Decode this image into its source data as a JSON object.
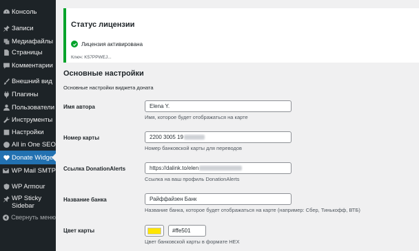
{
  "sidebar": {
    "items": [
      {
        "label": "Консоль",
        "icon": "dashboard-icon"
      },
      {
        "label": "Записи",
        "icon": "pin-icon"
      },
      {
        "label": "Медиафайлы",
        "icon": "media-icon"
      },
      {
        "label": "Страницы",
        "icon": "pages-icon"
      },
      {
        "label": "Комментарии",
        "icon": "comment-icon"
      },
      {
        "label": "Внешний вид",
        "icon": "brush-icon"
      },
      {
        "label": "Плагины",
        "icon": "plugin-icon"
      },
      {
        "label": "Пользователи",
        "icon": "users-icon"
      },
      {
        "label": "Инструменты",
        "icon": "wrench-icon"
      },
      {
        "label": "Настройки",
        "icon": "settings-icon"
      },
      {
        "label": "All in One SEO",
        "icon": "seo-icon"
      },
      {
        "label": "Donate Widget",
        "icon": "donate-icon"
      },
      {
        "label": "WP Mail SMTP",
        "icon": "mail-icon"
      },
      {
        "label": "WP Armour",
        "icon": "shield-icon"
      },
      {
        "label": "WP Sticky Sidebar",
        "icon": "sticky-icon"
      },
      {
        "label": "Свернуть меню",
        "icon": "collapse-icon"
      }
    ]
  },
  "notice": {
    "title": "Статус лицензии",
    "status": "Лицензия активирована",
    "key": "Ключ: K57PPWEJ..."
  },
  "settings": {
    "title": "Основные настройки",
    "description": "Основные настройки виджета доната",
    "author": {
      "label": "Имя автора",
      "value": "Elena Y.",
      "hint": "Имя, которое будет отображаться на карте"
    },
    "card": {
      "label": "Номер карты",
      "value": "2200 3005 19",
      "hint": "Номер банковской карты для переводов"
    },
    "link": {
      "label": "Ссылка DonationAlerts",
      "value": "https://dalink.to/elen",
      "hint": "Ссылка на ваш профиль DonationAlerts"
    },
    "bank": {
      "label": "Название банка",
      "value": "Райффайзен Банк",
      "hint": "Название банка, которое будет отображаться на карте (например: Сбер, Тинькофф, ВТБ)"
    },
    "color": {
      "label": "Цвет карты",
      "value": "#ffe501",
      "hint": "Цвет банковской карты в формате HEX",
      "swatch": "#ffe501"
    }
  },
  "colors": {
    "sidebar": "#1d2327",
    "active": "#2271b1",
    "success": "#00a32a"
  }
}
